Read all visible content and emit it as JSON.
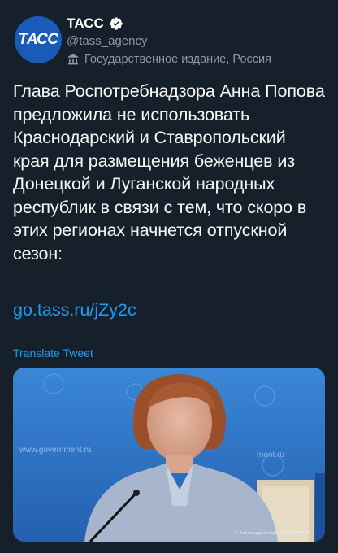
{
  "account": {
    "name": "ТАСС",
    "handle": "@tass_agency",
    "label": "Государственное издание, Россия",
    "avatar_text": "ТАСС",
    "brand_color": "#1b5bb8"
  },
  "tweet": {
    "text": "Глава Роспотребнадзора Анна Попова предложила не использовать Краснодарский и Ставропольский края для размещения беженцев из Донецкой и Луганской народных республик в связи с тем, что скоро в этих регионах начнется отпускной сезон:",
    "link": "go.tass.ru/jZy2c",
    "translate": "Translate Tweet"
  },
  "media": {
    "backdrop_text": "www.government.ru",
    "credit": "© Александр Астафьев/POOL/ТАСС"
  },
  "colors": {
    "background": "#15202b",
    "accent": "#1d9bf0",
    "secondary_text": "#8b98a5"
  },
  "icons": {
    "verified": "verified-badge-icon",
    "government": "government-label-icon"
  }
}
